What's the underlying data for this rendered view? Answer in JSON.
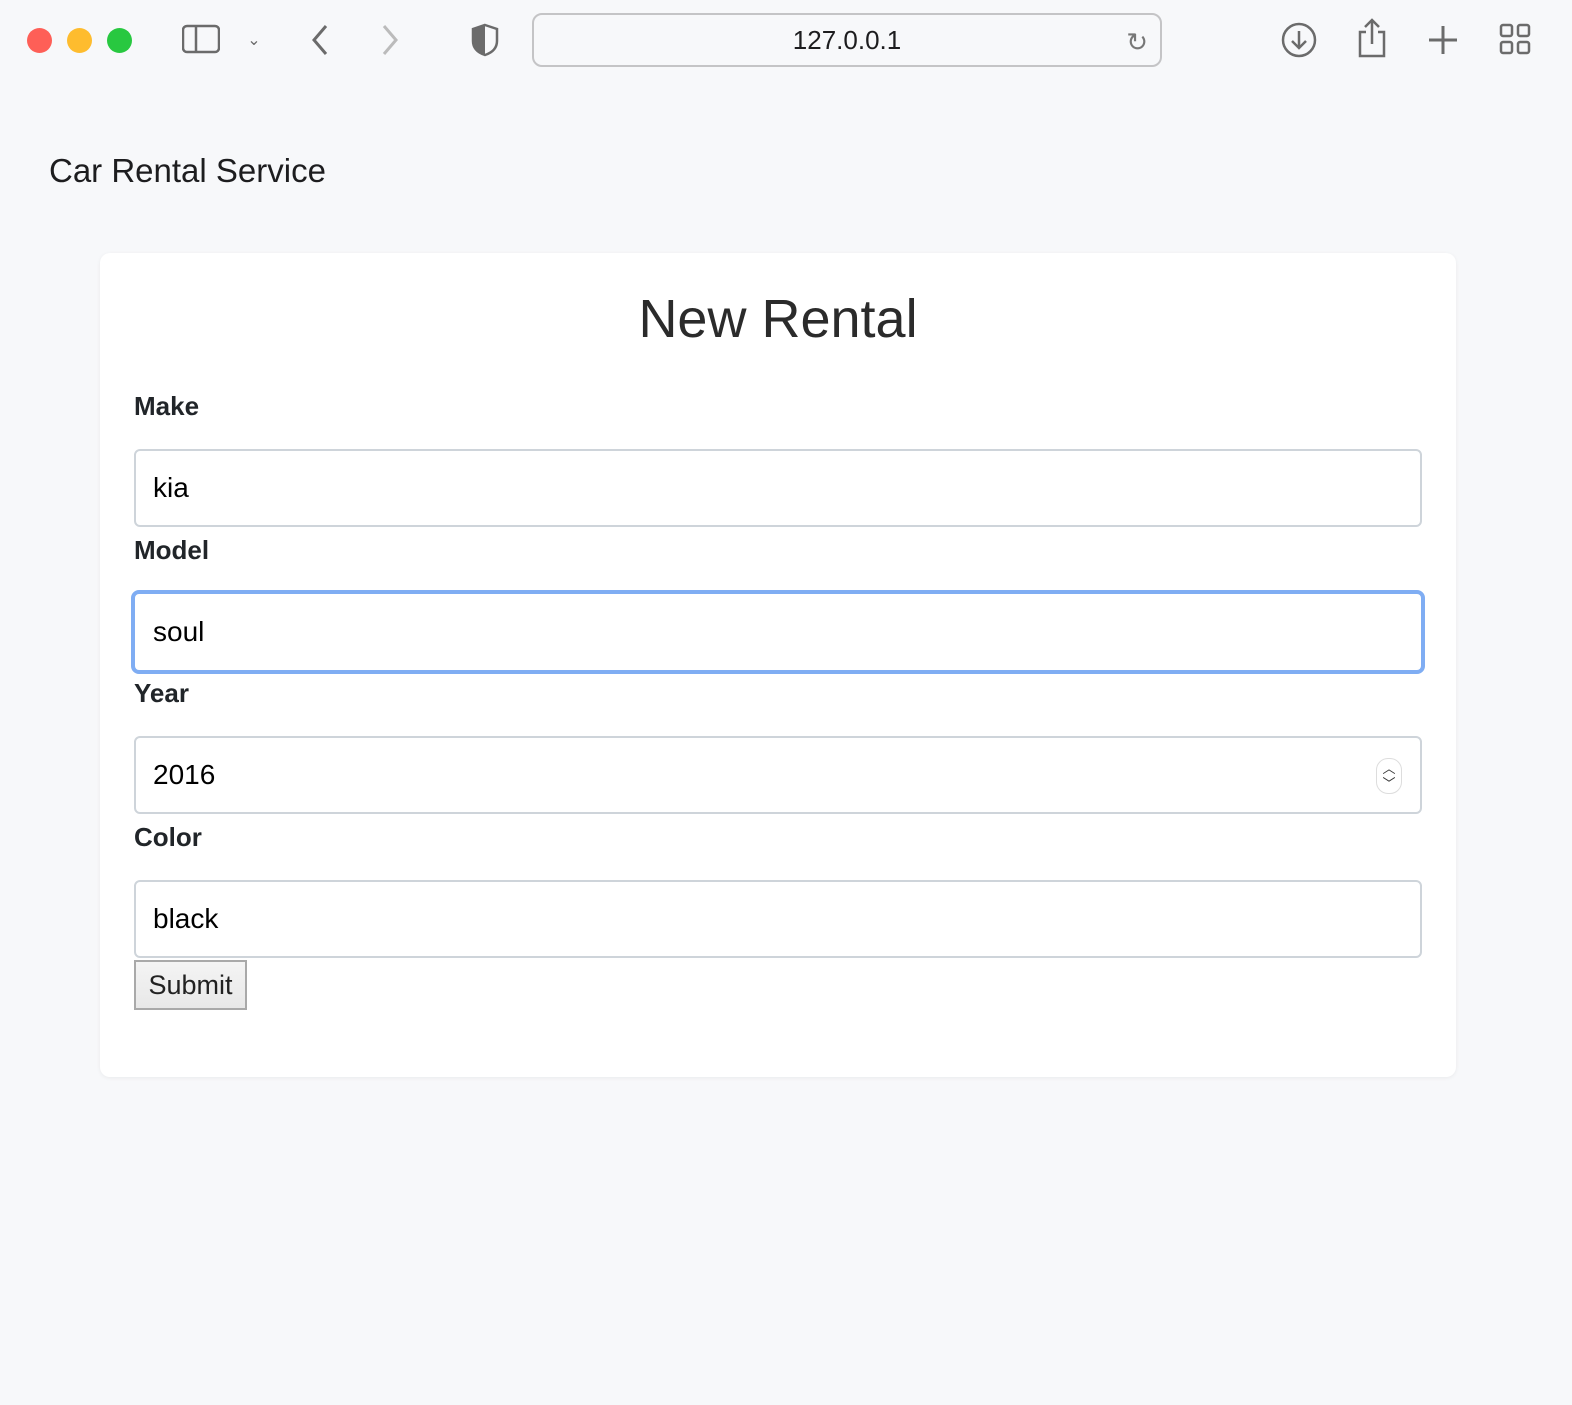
{
  "browser": {
    "url": "127.0.0.1",
    "colors": {
      "close": "#fe5f57",
      "minimize": "#febc2e",
      "zoom": "#28c840"
    }
  },
  "header": {
    "brand": "Car Rental Service"
  },
  "form": {
    "title": "New Rental",
    "fields": [
      {
        "label": "Make",
        "value": "kia"
      },
      {
        "label": "Model",
        "value": "soul",
        "focused": true
      },
      {
        "label": "Year",
        "value": "2016",
        "type": "number"
      },
      {
        "label": "Color",
        "value": "black"
      }
    ],
    "submit_label": "Submit",
    "focus_color": "#7fadf3"
  }
}
